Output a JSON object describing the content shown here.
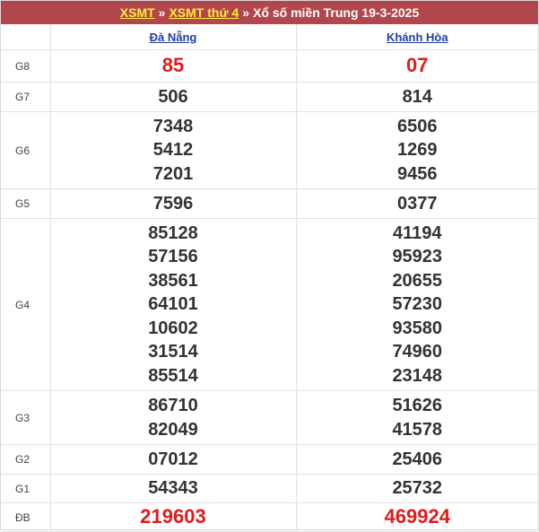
{
  "header": {
    "link1": "XSMT",
    "sep": "»",
    "link2": "XSMT thứ 4",
    "title": "Xổ số miền Trung 19-3-2025"
  },
  "provinces": [
    "Đà Nẵng",
    "Khánh Hòa"
  ],
  "prizes": [
    {
      "label": "G8",
      "cols": [
        [
          "85"
        ],
        [
          "07"
        ]
      ]
    },
    {
      "label": "G7",
      "cols": [
        [
          "506"
        ],
        [
          "814"
        ]
      ]
    },
    {
      "label": "G6",
      "cols": [
        [
          "7348",
          "5412",
          "7201"
        ],
        [
          "6506",
          "1269",
          "9456"
        ]
      ]
    },
    {
      "label": "G5",
      "cols": [
        [
          "7596"
        ],
        [
          "0377"
        ]
      ]
    },
    {
      "label": "G4",
      "cols": [
        [
          "85128",
          "57156",
          "38561",
          "64101",
          "10602",
          "31514",
          "85514"
        ],
        [
          "41194",
          "95923",
          "20655",
          "57230",
          "93580",
          "74960",
          "23148"
        ]
      ]
    },
    {
      "label": "G3",
      "cols": [
        [
          "86710",
          "82049"
        ],
        [
          "51626",
          "41578"
        ]
      ]
    },
    {
      "label": "G2",
      "cols": [
        [
          "07012"
        ],
        [
          "25406"
        ]
      ]
    },
    {
      "label": "G1",
      "cols": [
        [
          "54343"
        ],
        [
          "25732"
        ]
      ]
    },
    {
      "label": "ĐB",
      "cols": [
        [
          "219603"
        ],
        [
          "469924"
        ]
      ]
    }
  ],
  "colors": {
    "header_bg": "#b2464d",
    "header_link": "#ffef3a",
    "province_link": "#1f3ea8",
    "highlight": "#e21a1a"
  }
}
